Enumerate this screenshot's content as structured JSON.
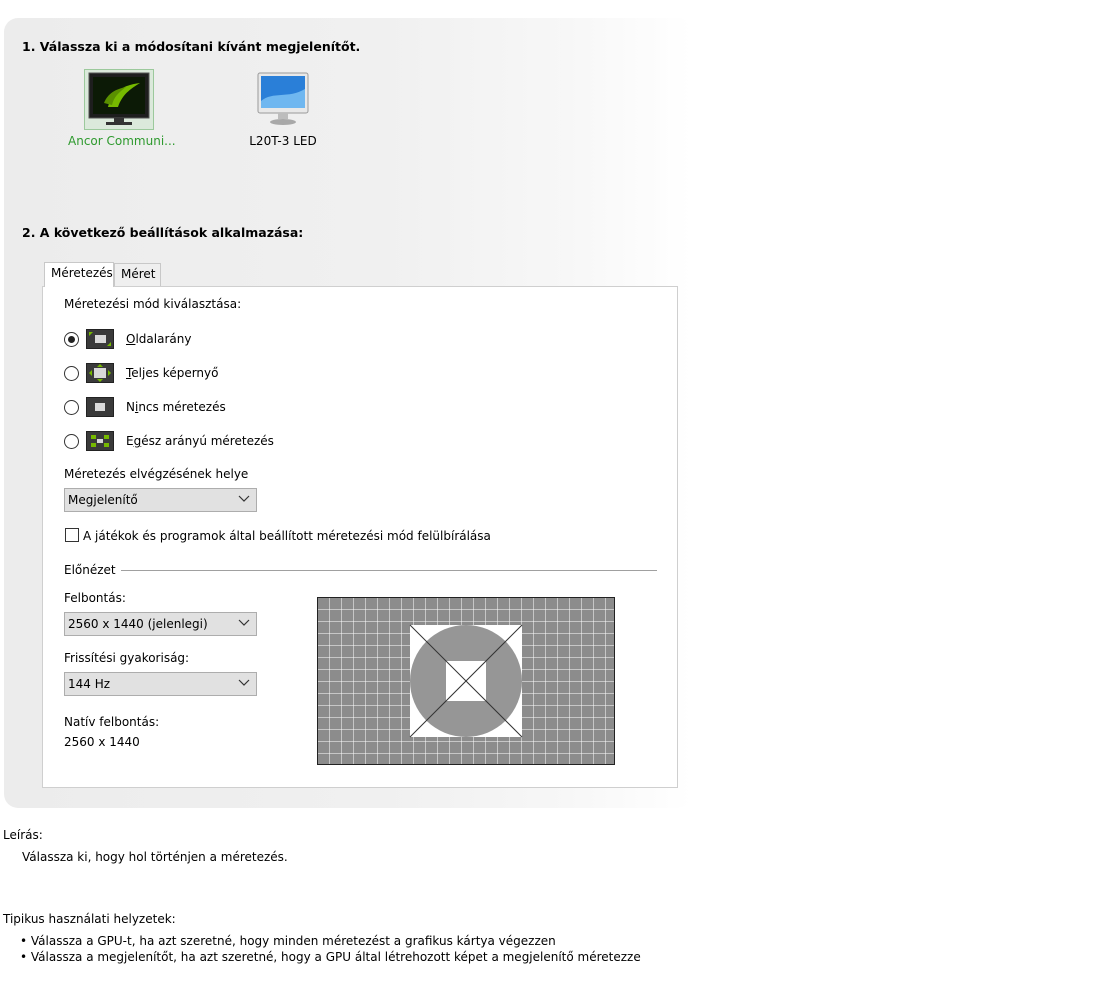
{
  "step1": {
    "title": "1. Válassza ki a módosítani kívánt megjelenítőt."
  },
  "monitors": [
    {
      "label": "Ancor Communi...",
      "selected": true
    },
    {
      "label": "L20T-3 LED",
      "selected": false
    }
  ],
  "step2": {
    "title": "2. A következő beállítások alkalmazása:"
  },
  "tabs": [
    {
      "label": "Méretezés",
      "active": true
    },
    {
      "label": "Méret",
      "active": false
    }
  ],
  "scaling": {
    "mode_label": "Méretezési mód kiválasztása:",
    "options": [
      {
        "mnemonic": "O",
        "rest": "ldalarány",
        "checked": true,
        "icon": "aspect-ratio-icon"
      },
      {
        "mnemonic": "T",
        "rest": "eljes képernyő",
        "checked": false,
        "icon": "fullscreen-icon"
      },
      {
        "prefix": "N",
        "mnemonic": "i",
        "rest": "ncs méretezés",
        "checked": false,
        "icon": "no-scaling-icon"
      },
      {
        "prefix": "E",
        "mnemonic": "g",
        "rest": "ész arányú méretezés",
        "checked": false,
        "icon": "integer-scaling-icon"
      }
    ],
    "location_label": "Méretezés elvégzésének helye",
    "location_value": "Megjelenítő",
    "override_label": "A játékok és programok által beállított méretezési mód felülbírálása",
    "override_checked": false
  },
  "preview": {
    "title": "Előnézet",
    "resolution_label": "Felbontás:",
    "resolution_value": "2560 x 1440 (jelenlegi)",
    "refresh_label": "Frissítési gyakoriság:",
    "refresh_value": "144 Hz",
    "native_label": "Natív felbontás:",
    "native_value": "2560 x 1440"
  },
  "description": {
    "label": "Leírás:",
    "text": "Válassza ki, hogy hol történjen a méretezés."
  },
  "usage": {
    "label": "Tipikus használati helyzetek:",
    "items": [
      "Válassza a GPU-t, ha azt szeretné, hogy minden méretezést a grafikus kártya végezzen",
      "Válassza a megjelenítőt, ha azt szeretné, hogy a GPU által létrehozott képet a megjelenítő méretezze"
    ]
  },
  "colors": {
    "accent_green": "#2e9a2e",
    "nvidia_green": "#76b900"
  }
}
